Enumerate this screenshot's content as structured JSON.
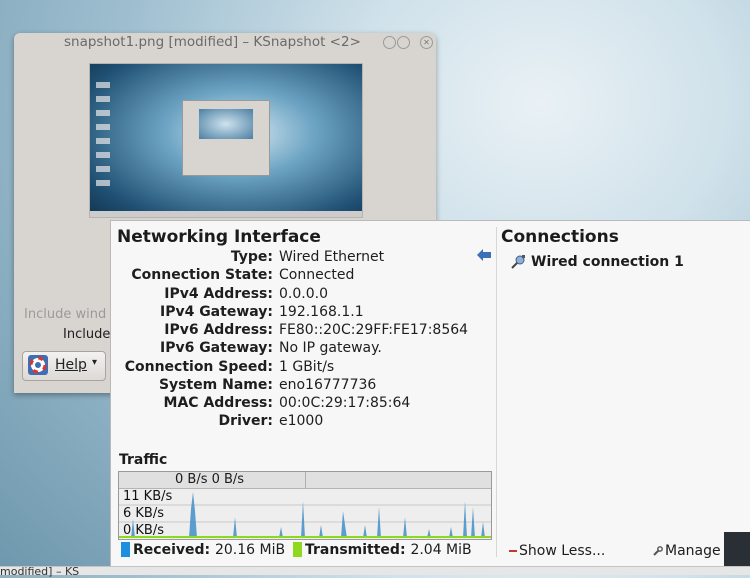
{
  "ksnapshot": {
    "title": "snapshot1.png [modified] – KSnapshot <2>",
    "include_window_partial": "Include wind",
    "include_partial": "Include",
    "help_label": "Help"
  },
  "networking": {
    "title": "Networking Interface",
    "fields": [
      {
        "key": "Type:",
        "value": "Wired Ethernet"
      },
      {
        "key": "Connection State:",
        "value": "Connected"
      },
      {
        "key": "IPv4 Address:",
        "value": "0.0.0.0"
      },
      {
        "key": "IPv4 Gateway:",
        "value": "192.168.1.1"
      },
      {
        "key": "IPv6 Address:",
        "value": "FE80::20C:29FF:FE17:8564"
      },
      {
        "key": "IPv6 Gateway:",
        "value": "No IP gateway."
      },
      {
        "key": "Connection Speed:",
        "value": "1 GBit/s"
      },
      {
        "key": "System Name:",
        "value": "eno16777736"
      },
      {
        "key": "MAC Address:",
        "value": "00:0C:29:17:85:64"
      },
      {
        "key": "Driver:",
        "value": "e1000"
      }
    ]
  },
  "connections": {
    "title": "Connections",
    "items": [
      {
        "label": "Wired connection 1"
      }
    ]
  },
  "traffic": {
    "label": "Traffic",
    "rates": "0 B/s 0 B/s",
    "scale_labels": [
      "11 KB/s",
      "6 KB/s",
      "0 KB/s"
    ],
    "received_label": "Received:",
    "received_value": "20.16 MiB",
    "transmitted_label": "Transmitted:",
    "transmitted_value": "2.04 MiB",
    "received_color": "#1e8fe0",
    "transmitted_color": "#8ed81e"
  },
  "actions": {
    "show_less": "Show Less...",
    "manage": "Manage Co"
  },
  "taskbar": {
    "text": "modified] – KS"
  }
}
